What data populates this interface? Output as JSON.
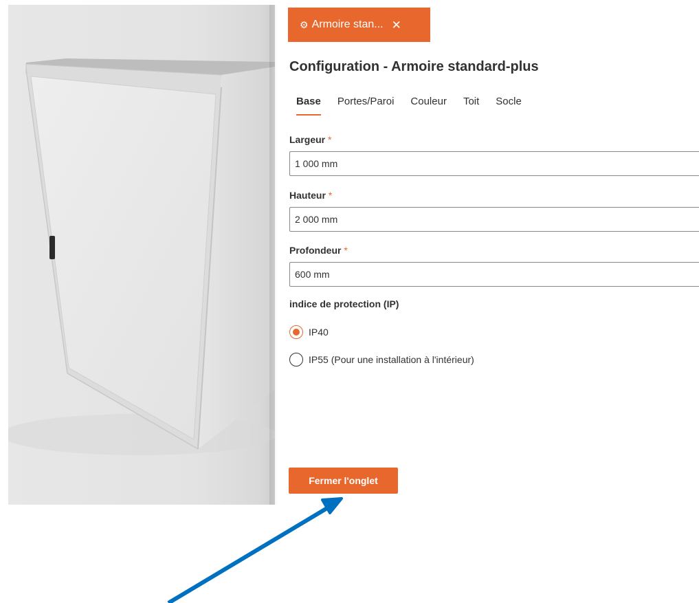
{
  "tab": {
    "label": "Armoire stan...",
    "icon": "gears-icon",
    "close_icon": "close-icon",
    "accent": "#e8672c"
  },
  "page_title": "Configuration - Armoire standard-plus",
  "section_tabs": [
    {
      "label": "Base",
      "active": true
    },
    {
      "label": "Portes/Paroi",
      "active": false
    },
    {
      "label": "Couleur",
      "active": false
    },
    {
      "label": "Toit",
      "active": false
    },
    {
      "label": "Socle",
      "active": false
    }
  ],
  "fields": {
    "largeur": {
      "label": "Largeur",
      "required_mark": "*",
      "value": "1 000 mm"
    },
    "hauteur": {
      "label": "Hauteur",
      "required_mark": "*",
      "value": "2 000 mm"
    },
    "profondeur": {
      "label": "Profondeur",
      "required_mark": "*",
      "value": "600 mm"
    }
  },
  "protection": {
    "label": "indice de protection (IP)",
    "options": [
      {
        "label": "IP40",
        "selected": true
      },
      {
        "label": "IP55 (Pour une installation à l'intérieur)",
        "selected": false
      }
    ]
  },
  "close_button_label": "Fermer l'onglet",
  "annotation": {
    "arrow_color": "#0070c0"
  }
}
